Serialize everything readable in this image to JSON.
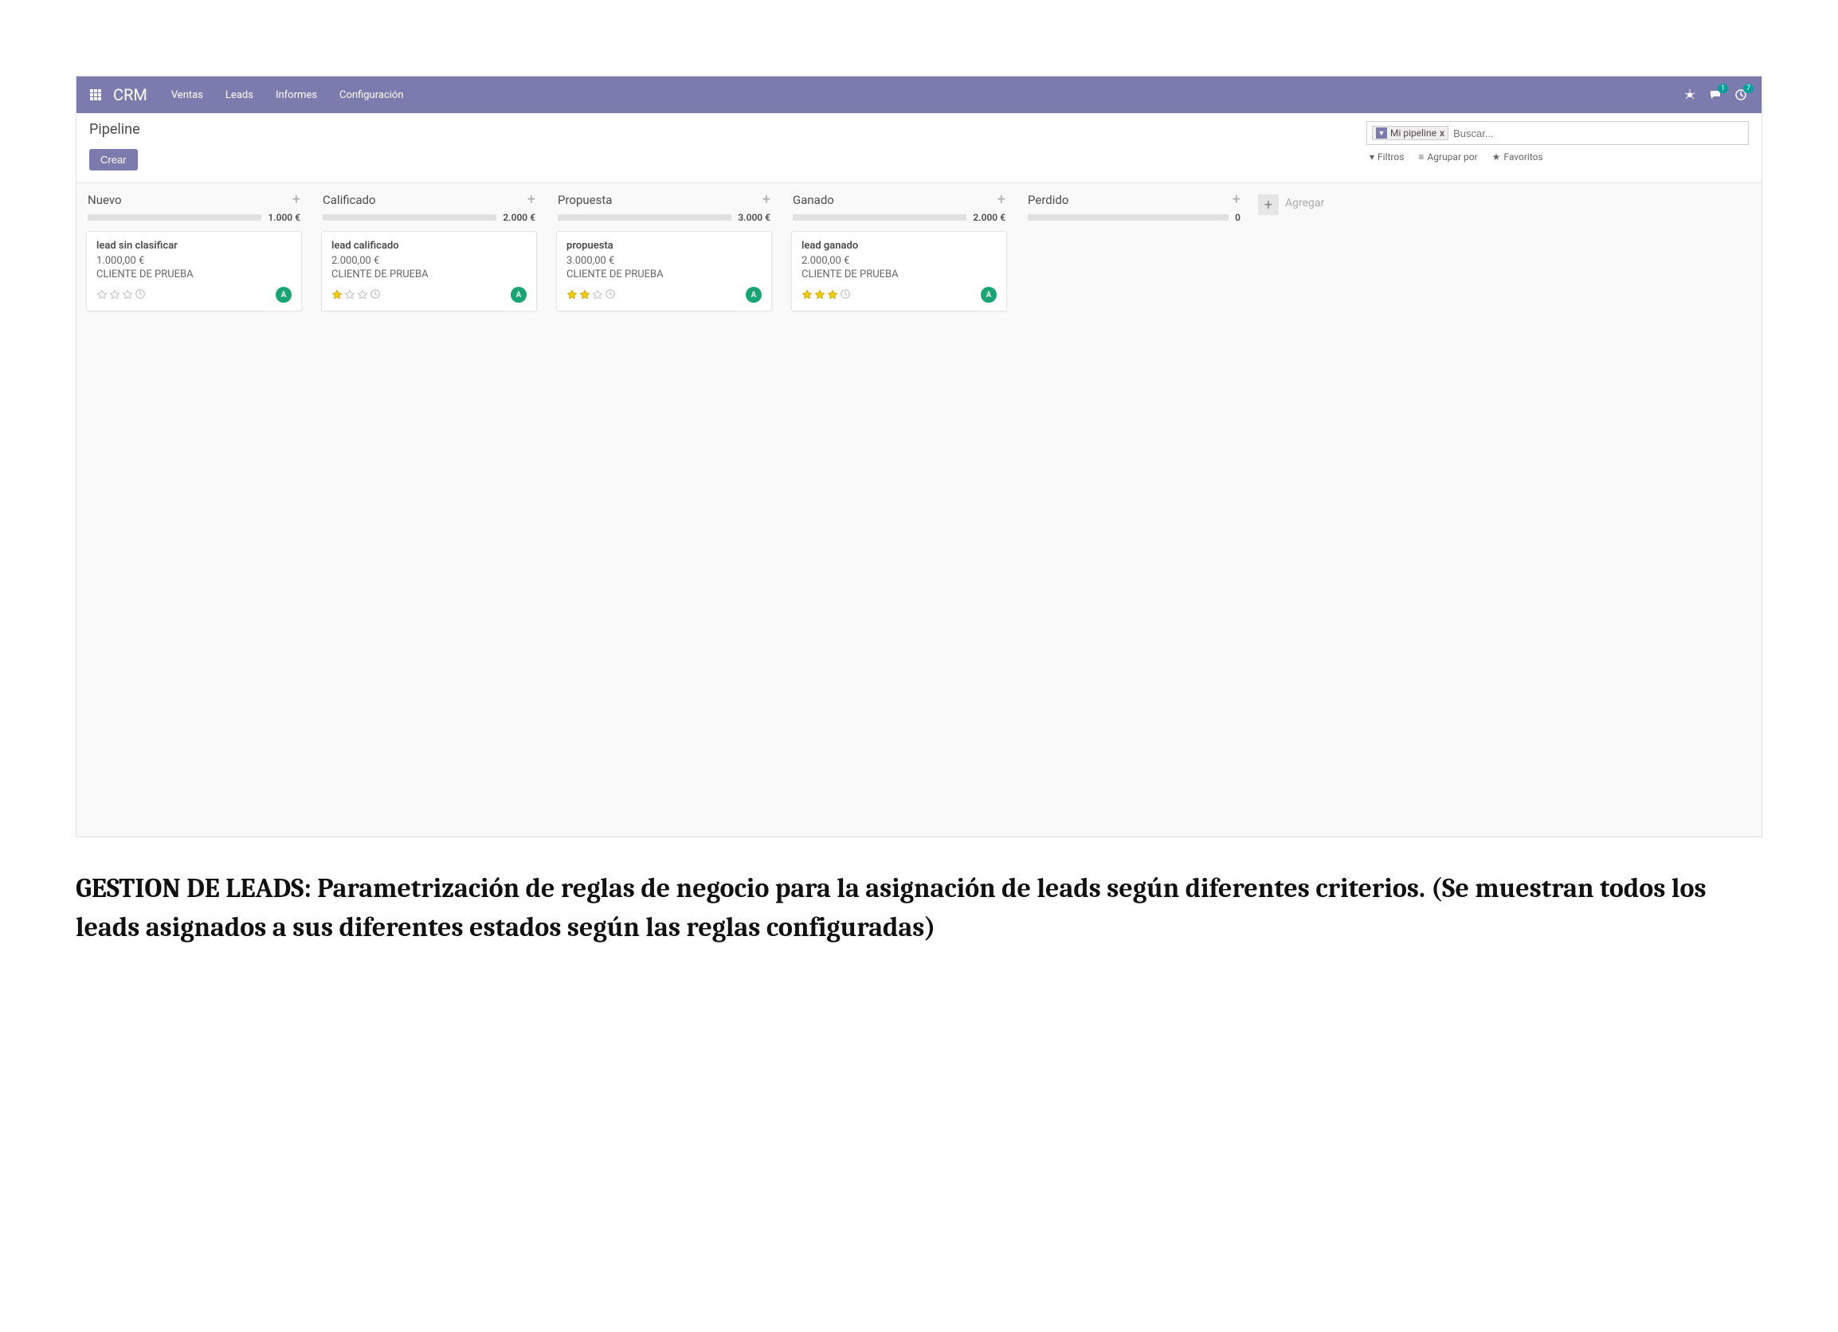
{
  "navbar": {
    "brand": "CRM",
    "items": [
      "Ventas",
      "Leads",
      "Informes",
      "Configuración"
    ],
    "badges": {
      "chat": "1",
      "clock": "7"
    }
  },
  "control": {
    "title": "Pipeline",
    "create": "Crear",
    "search": {
      "chip_label": "Mi pipeline",
      "chip_x": "x",
      "placeholder": "Buscar...",
      "filters": "Filtros",
      "groupby": "Agrupar por",
      "favorites": "Favoritos"
    }
  },
  "columns": [
    {
      "title": "Nuevo",
      "total": "1.000 €",
      "cards": [
        {
          "title": "lead sin clasificar",
          "amount": "1.000,00 €",
          "client": "CLIENTE DE PRUEBA",
          "stars": 0,
          "avatar": "A"
        }
      ]
    },
    {
      "title": "Calificado",
      "total": "2.000 €",
      "cards": [
        {
          "title": "lead calificado",
          "amount": "2.000,00 €",
          "client": "CLIENTE DE PRUEBA",
          "stars": 1,
          "avatar": "A"
        }
      ]
    },
    {
      "title": "Propuesta",
      "total": "3.000 €",
      "cards": [
        {
          "title": "propuesta",
          "amount": "3.000,00 €",
          "client": "CLIENTE DE PRUEBA",
          "stars": 2,
          "avatar": "A"
        }
      ]
    },
    {
      "title": "Ganado",
      "total": "2.000 €",
      "cards": [
        {
          "title": "lead ganado",
          "amount": "2.000,00 €",
          "client": "CLIENTE DE PRUEBA",
          "stars": 3,
          "avatar": "A"
        }
      ]
    },
    {
      "title": "Perdido",
      "total": "0",
      "cards": []
    }
  ],
  "add_column": "Agregar",
  "caption": "GESTION DE LEADS: Parametrización de reglas de negocio para la asignación de leads según diferentes criterios. (Se muestran todos los leads asignados a sus diferentes estados según las reglas configuradas)"
}
